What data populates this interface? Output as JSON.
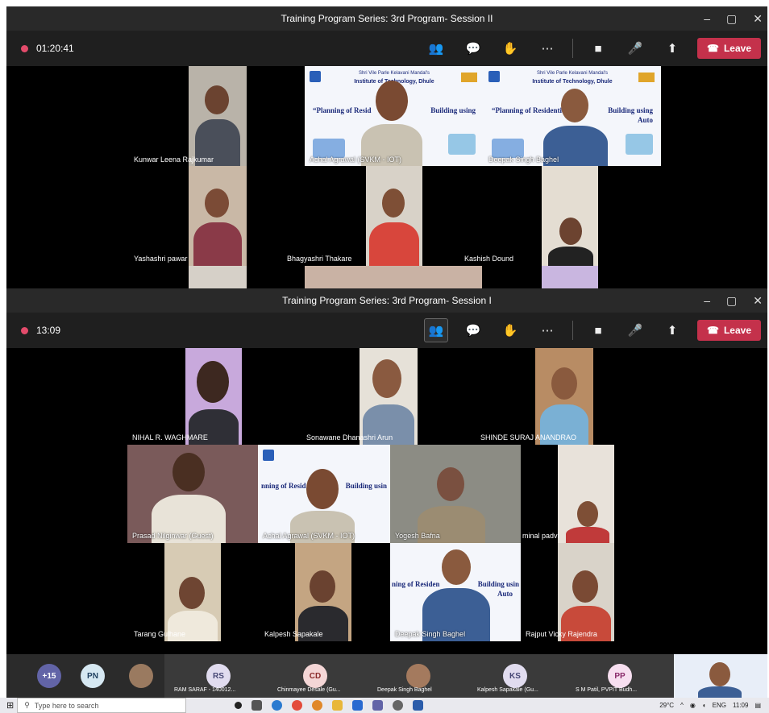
{
  "window1": {
    "title": "Training Program Series: 3rd Program- Session II",
    "timer": "01:20:41",
    "leave_label": "Leave",
    "participants": [
      "Kunwar Leena Rajkumar",
      "Achal Agrawal (SVKM - IOT)",
      "Deepak Singh Baghel",
      "Yashashri pawar",
      "Bhagyashri Thakare",
      "Kashish Dound"
    ],
    "slide": {
      "header": "Shri Vile Parle Kelavani Mandal's",
      "institute": "Institute of Technology, Dhule",
      "title_part1": "“Planning of Resid",
      "title_part2": "Building using",
      "title_full": "“Planning of Residential",
      "title_full2": "Building using",
      "sub": "Auto"
    }
  },
  "window2": {
    "title": "Training Program Series: 3rd Program- Session I",
    "timer": "13:09",
    "leave_label": "Leave",
    "participants": [
      "NIHAL R. WAGHMARE",
      "Sonawane Dhanashri Arun",
      "SHINDE SURAJ ANANDRAO",
      "Prasad Nilginwar (Guest)",
      "Achal Agrawal (SVKM - IOT)",
      "Yogesh Bafna",
      "minal padvi",
      "Tarang Gulhane",
      "Kalpesh Sapakale",
      "Deepak Singh Baghel",
      "Rajput Vicky Rajendra"
    ],
    "slide": {
      "title_a": "nning of Resid",
      "title_b": "Building usin",
      "title_c": "ning of Residen",
      "title_d": "Building usin",
      "sub": "Auto"
    }
  },
  "gallery": {
    "overflow": "+15",
    "items": [
      {
        "initials": "PN",
        "name": ""
      },
      {
        "initials": "",
        "name": ""
      },
      {
        "initials": "RS",
        "name": "RAM SARAF - 140012..."
      },
      {
        "initials": "CD",
        "name": "Chinmayee Desale (Gu..."
      },
      {
        "initials": "",
        "name": "Deepak Singh Baghel"
      },
      {
        "initials": "KS",
        "name": "Kalpesh Sapakale (Gu..."
      },
      {
        "initials": "PP",
        "name": "S M Patil, PVPIT Budh..."
      }
    ]
  },
  "taskbar": {
    "search_placeholder": "Type here to search",
    "weather": "29°C",
    "lang": "ENG",
    "time": "11:09"
  },
  "colors": {
    "leave": "#c4314b",
    "record": "#e34b6b",
    "titlebar": "#292929",
    "toolbar": "#1f1f1f"
  }
}
